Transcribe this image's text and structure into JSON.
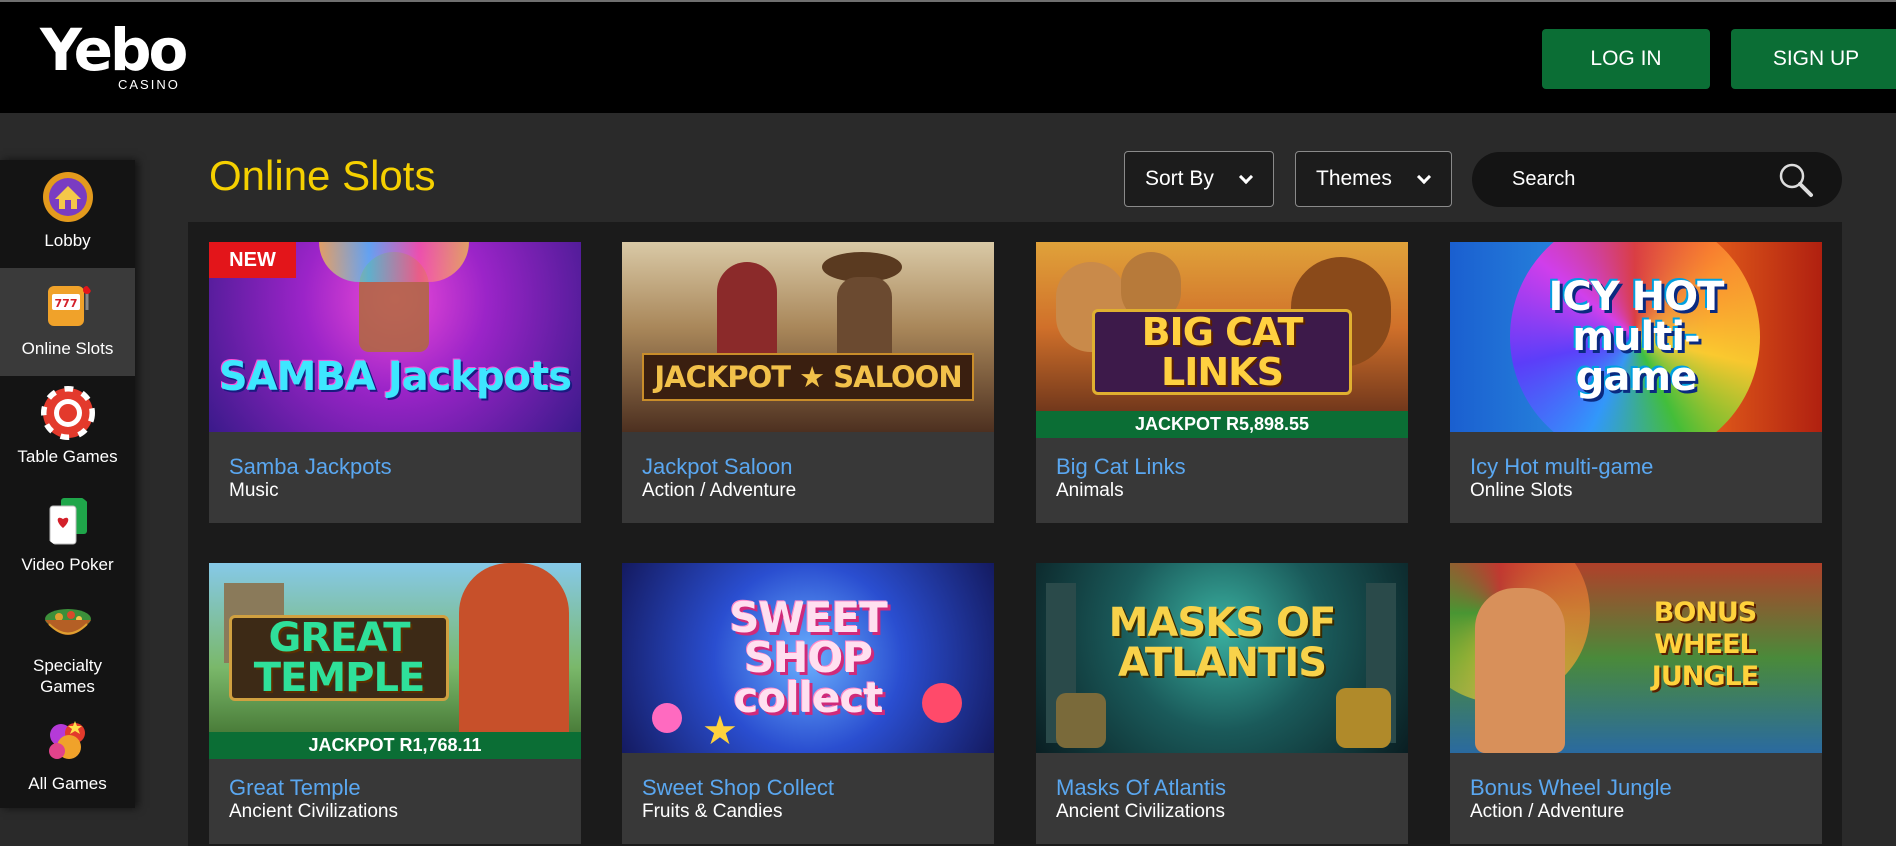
{
  "header": {
    "logo_text": "Yebo",
    "logo_sub": "CASINO",
    "login_label": "LOG IN",
    "signup_label": "SIGN UP"
  },
  "sidebar": {
    "items": [
      {
        "label": "Lobby",
        "icon": "lobby-icon"
      },
      {
        "label": "Online Slots",
        "icon": "slot-machine-icon",
        "active": true
      },
      {
        "label": "Table Games",
        "icon": "poker-chip-icon"
      },
      {
        "label": "Video Poker",
        "icon": "playing-cards-icon"
      },
      {
        "label": "Specialty Games",
        "icon": "specialty-bowl-icon"
      },
      {
        "label": "All Games",
        "icon": "all-games-icon"
      }
    ]
  },
  "main": {
    "title": "Online Slots",
    "sort_label": "Sort By",
    "themes_label": "Themes",
    "search_placeholder": "Search"
  },
  "games": [
    {
      "name": "Samba Jackpots",
      "category": "Music",
      "badge": "NEW",
      "art_text": "SAMBA Jackpots"
    },
    {
      "name": "Jackpot Saloon",
      "category": "Action / Adventure",
      "art_text": "JACKPOT ★ SALOON"
    },
    {
      "name": "Big Cat Links",
      "category": "Animals",
      "jackpot": "JACKPOT R5,898.55",
      "art_text": "BIG CAT LINKS"
    },
    {
      "name": "Icy Hot multi-game",
      "category": "Online Slots",
      "art_text": "ICY HOT multi-game"
    },
    {
      "name": "Great Temple",
      "category": "Ancient Civilizations",
      "jackpot": "JACKPOT R1,768.11",
      "art_text": "GREAT TEMPLE"
    },
    {
      "name": "Sweet Shop Collect",
      "category": "Fruits & Candies",
      "art_text": "SWEET SHOP collect"
    },
    {
      "name": "Masks Of Atlantis",
      "category": "Ancient Civilizations",
      "art_text": "MASKS OF ATLANTIS"
    },
    {
      "name": "Bonus Wheel Jungle",
      "category": "Action / Adventure",
      "art_text": "BONUS WHEEL JUNGLE"
    }
  ],
  "colors": {
    "accent_green": "#0b6e35",
    "title_yellow": "#f5d000",
    "link_blue": "#5aa7f0",
    "new_red": "#e3151a"
  }
}
